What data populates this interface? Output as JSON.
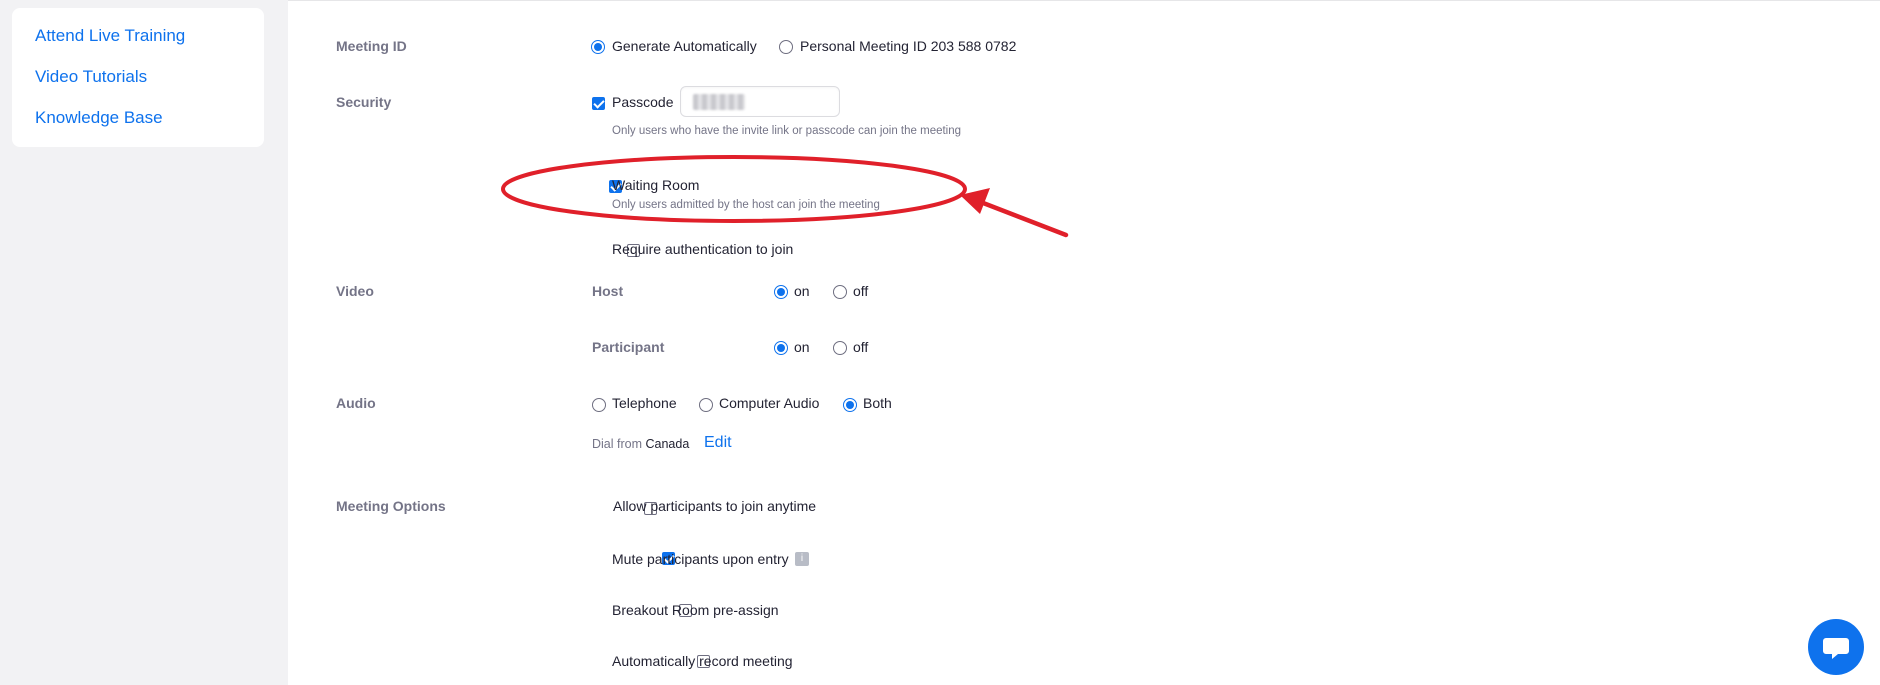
{
  "sidebar": {
    "items": [
      {
        "label": "Attend Live Training"
      },
      {
        "label": "Video Tutorials"
      },
      {
        "label": "Knowledge Base"
      }
    ]
  },
  "meeting_id": {
    "label": "Meeting ID",
    "options": [
      {
        "label": "Generate Automatically",
        "selected": true
      },
      {
        "label": "Personal Meeting ID 203 588 0782",
        "selected": false
      }
    ]
  },
  "security": {
    "label": "Security",
    "passcode": {
      "label": "Passcode",
      "checked": true,
      "hint": "Only users who have the invite link or passcode can join the meeting"
    },
    "waiting_room": {
      "label": "Waiting Room",
      "checked": true,
      "hint": "Only users admitted by the host can join the meeting"
    },
    "require_auth": {
      "label": "Require authentication to join",
      "checked": false
    }
  },
  "video": {
    "label": "Video",
    "host": {
      "label": "Host",
      "on": "on",
      "off": "off",
      "value": "on"
    },
    "participant": {
      "label": "Participant",
      "on": "on",
      "off": "off",
      "value": "on"
    }
  },
  "audio": {
    "label": "Audio",
    "options": [
      {
        "label": "Telephone",
        "selected": false
      },
      {
        "label": "Computer Audio",
        "selected": false
      },
      {
        "label": "Both",
        "selected": true
      }
    ],
    "dial_from_prefix": "Dial from",
    "dial_from_country": "Canada",
    "edit_label": "Edit"
  },
  "meeting_options": {
    "label": "Meeting Options",
    "items": [
      {
        "label": "Allow participants to join anytime",
        "checked": false
      },
      {
        "label": "Mute participants upon entry",
        "checked": true
      },
      {
        "label": "Breakout Room pre-assign",
        "checked": false
      },
      {
        "label": "Automatically record meeting",
        "checked": false
      }
    ]
  },
  "colors": {
    "accent": "#0e72ed",
    "annotation": "#e0202a",
    "sidebar_bg": "#f2f2f4"
  },
  "icons": {
    "chat": "chat-bubble-icon",
    "info": "info-icon"
  }
}
